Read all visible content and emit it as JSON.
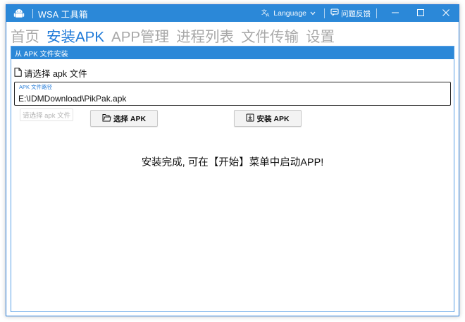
{
  "app": {
    "title": "WSA 工具箱",
    "language_label": "Language",
    "feedback_label": "问题反馈",
    "accent_color": "#2b88d8"
  },
  "nav": {
    "tabs": [
      {
        "label": "首页",
        "active": false
      },
      {
        "label": "安装APK",
        "active": true
      },
      {
        "label": "APP管理",
        "active": false
      },
      {
        "label": "进程列表",
        "active": false
      },
      {
        "label": "文件传输",
        "active": false
      },
      {
        "label": "设置",
        "active": false
      }
    ]
  },
  "panel": {
    "header": "从 APK 文件安装",
    "file_prompt": "请选择 apk 文件",
    "path_label": "APK 文件路径",
    "path_value": "E:\\IDMDownload\\PikPak.apk",
    "hint": "请选择 apk 文件",
    "select_button": "选择 APK",
    "install_button": "安装 APK",
    "status": "安装完成, 可在【开始】菜单中启动APP!"
  },
  "icons": {
    "app": "android-icon",
    "language": "translate-icon",
    "feedback": "feedback-icon",
    "file": "file-icon",
    "select": "folder-icon",
    "install": "install-icon"
  }
}
